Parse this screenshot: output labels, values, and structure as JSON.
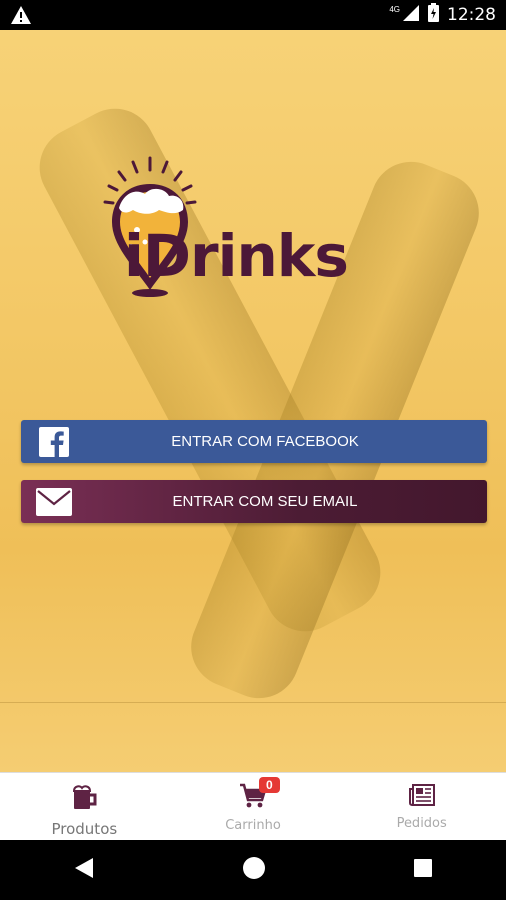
{
  "status_bar": {
    "time": "12:28",
    "network": "4G",
    "icons": [
      "warning-icon",
      "signal-icon",
      "battery-icon"
    ]
  },
  "brand": {
    "name": "iDrinks",
    "colors": {
      "primary": "#4c1838",
      "accent": "#f3c866"
    }
  },
  "auth": {
    "facebook_label": "ENTRAR COM FACEBOOK",
    "email_label": "ENTRAR COM SEU EMAIL",
    "facebook_color": "#3b5998"
  },
  "bottom_nav": {
    "items": [
      {
        "label": "Produtos",
        "icon": "beer-mug-icon"
      },
      {
        "label": "Carrinho",
        "icon": "cart-icon",
        "badge": "0"
      },
      {
        "label": "Pedidos",
        "icon": "newspaper-icon"
      }
    ]
  },
  "system_nav": [
    "back-icon",
    "home-icon",
    "recents-icon"
  ]
}
